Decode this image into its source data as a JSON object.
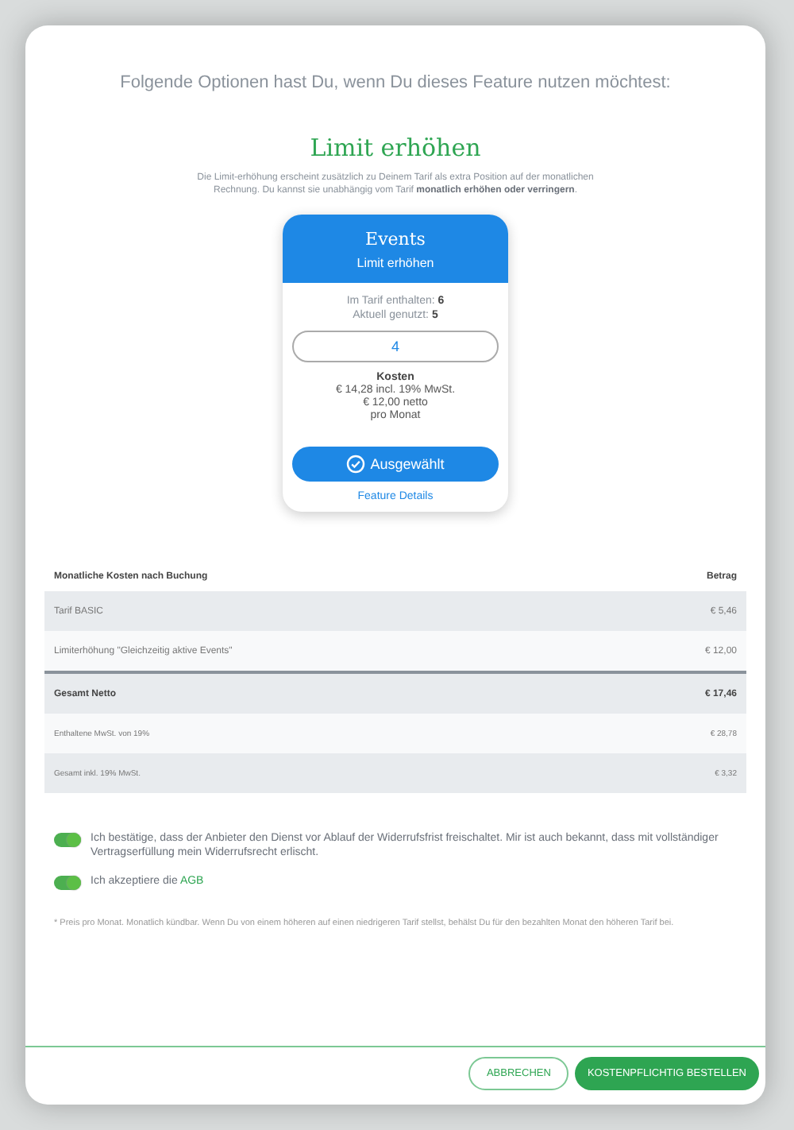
{
  "intro": "Folgende Optionen hast Du, wenn Du dieses Feature nutzen möchtest:",
  "option": {
    "title": "Limit erhöhen",
    "description": "Die Limit-erhöhung erscheint zusätzlich zu Deinem Tarif als extra Position auf der monatlichen Rechnung. Du kannst sie unabhängig vom Tarif **monatlich erhöhen oder verringern**."
  },
  "card": {
    "title": "Events",
    "subtitle": "Limit erhöhen",
    "info": [
      "Im Tarif enthalten: **6**",
      "Aktuell genutzt: **5**"
    ],
    "quantity": "4",
    "cost_label": "Kosten",
    "cost_lines": [
      "€ 14,28 incl. 19% MwSt.",
      "€ 12,00 netto",
      "pro Monat"
    ],
    "button": {
      "label": "Ausgewählt",
      "selected": true
    },
    "details_link": "Feature Details"
  },
  "table": {
    "columns": [
      "Monatliche Kosten nach Buchung",
      "Betrag"
    ],
    "rows": [
      {
        "kind": "item",
        "label": "Tarif BASIC",
        "amount": "€ 5,46"
      },
      {
        "kind": "item",
        "label": "Limiterhöhung \"Gleichzeitig aktive Events\"",
        "amount": "€ 12,00"
      },
      {
        "kind": "total",
        "label": "Gesamt Netto",
        "amount": "€ 17,46"
      },
      {
        "kind": "tax",
        "label": "Enthaltene MwSt. von 19%",
        "amount": "€ 28,78"
      },
      {
        "kind": "tax",
        "label": "Gesamt inkl. 19% MwSt.",
        "amount": "€ 3,32"
      }
    ]
  },
  "consents": [
    {
      "on": true,
      "text": "Ich bestätige, dass der Anbieter den Dienst vor Ablauf der Widerrufsfrist freischaltet. Mir ist auch bekannt, dass mit vollständiger Vertragserfüllung mein Widerrufsrecht erlischt."
    },
    {
      "on": true,
      "text": "Ich akzeptiere die ",
      "link": "AGB"
    }
  ],
  "footnote": "* Preis pro Monat. Monatlich kündbar. Wenn Du von einem höheren auf einen niedrigeren Tarif stellst, behälst Du für den bezahlten Monat den höheren Tarif bei.",
  "buttons": {
    "cancel": "ABBRECHEN",
    "confirm": "KOSTENPFLICHTIG BESTELLEN"
  }
}
